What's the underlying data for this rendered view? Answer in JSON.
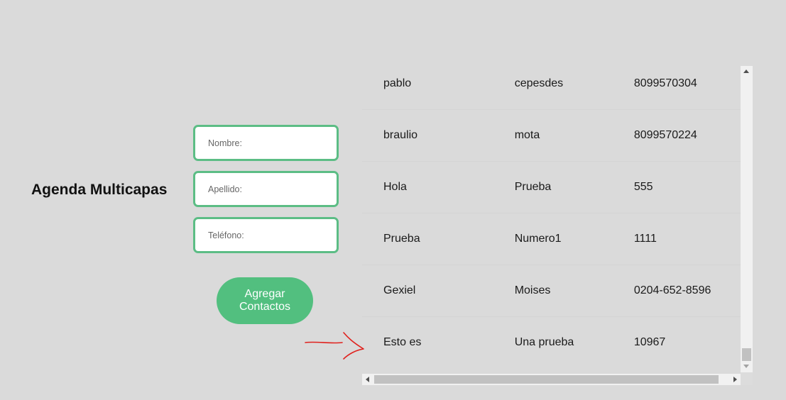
{
  "app": {
    "title": "Agenda Multicapas"
  },
  "form": {
    "nombre_placeholder": "Nombre:",
    "apellido_placeholder": "Apellido:",
    "telefono_placeholder": "Teléfono:",
    "nombre_value": "",
    "apellido_value": "",
    "telefono_value": "",
    "add_button_label": "Agregar Contactos"
  },
  "contacts": [
    {
      "nombre": "pablo",
      "apellido": "cepesdes",
      "telefono": "8099570304"
    },
    {
      "nombre": "braulio",
      "apellido": "mota",
      "telefono": "8099570224"
    },
    {
      "nombre": "Hola",
      "apellido": "Prueba",
      "telefono": "555"
    },
    {
      "nombre": "Prueba",
      "apellido": "Numero1",
      "telefono": "1111"
    },
    {
      "nombre": "Gexiel",
      "apellido": "Moises",
      "telefono": "0204-652-8596"
    },
    {
      "nombre": "Esto es",
      "apellido": "Una prueba",
      "telefono": "10967"
    }
  ],
  "annotation": {
    "icon": "red-hand-drawn-arrow-icon",
    "color": "#e0211d"
  },
  "colors": {
    "background": "#dadada",
    "accent": "#52bf7f",
    "field_border": "#5cbd85"
  }
}
